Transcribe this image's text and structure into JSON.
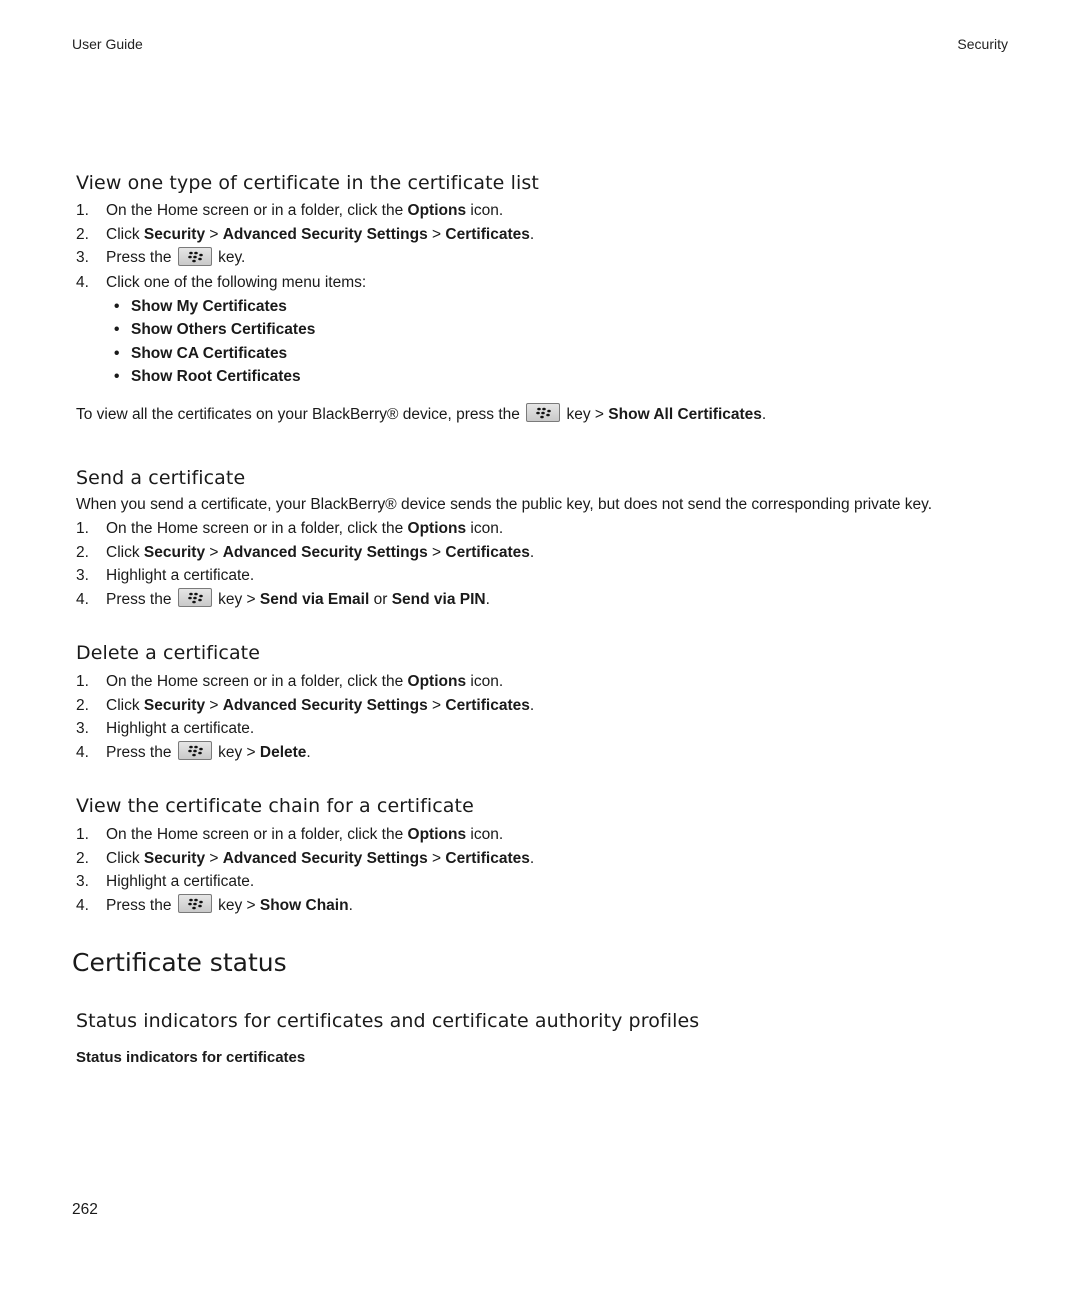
{
  "header": {
    "left": "User Guide",
    "right": "Security"
  },
  "sections": {
    "view_type": {
      "title": "View one type of certificate in the certificate list",
      "steps": {
        "s1": {
          "num": "1.",
          "pre": "On the Home screen or in a folder, click the ",
          "b1": "Options",
          "post": " icon."
        },
        "s2": {
          "num": "2.",
          "pre": "Click ",
          "b1": "Security",
          "sep1": " > ",
          "b2": "Advanced Security Settings",
          "sep2": " > ",
          "b3": "Certificates",
          "post": "."
        },
        "s3": {
          "num": "3.",
          "pre": "Press the ",
          "post": " key."
        },
        "s4": {
          "num": "4.",
          "text": "Click one of the following menu items:"
        }
      },
      "menu_items": [
        "Show My Certificates",
        "Show Others Certificates",
        "Show CA Certificates",
        "Show Root Certificates"
      ],
      "note": {
        "pre": "To view all the certificates on your BlackBerry® device, press the ",
        "mid": " key > ",
        "b1": "Show All Certificates",
        "post": "."
      }
    },
    "send": {
      "title": "Send a certificate",
      "intro": "When you send a certificate, your BlackBerry® device sends the public key, but does not send the corresponding private key.",
      "steps": {
        "s1": {
          "num": "1.",
          "pre": "On the Home screen or in a folder, click the ",
          "b1": "Options",
          "post": " icon."
        },
        "s2": {
          "num": "2.",
          "pre": "Click ",
          "b1": "Security",
          "sep1": " > ",
          "b2": "Advanced Security Settings",
          "sep2": " > ",
          "b3": "Certificates",
          "post": "."
        },
        "s3": {
          "num": "3.",
          "text": "Highlight a certificate."
        },
        "s4": {
          "num": "4.",
          "pre": "Press the ",
          "mid": " key > ",
          "b1": "Send via Email",
          "or": " or ",
          "b2": "Send via PIN",
          "post": "."
        }
      }
    },
    "delete": {
      "title": "Delete a certificate",
      "steps": {
        "s1": {
          "num": "1.",
          "pre": "On the Home screen or in a folder, click the ",
          "b1": "Options",
          "post": " icon."
        },
        "s2": {
          "num": "2.",
          "pre": "Click ",
          "b1": "Security",
          "sep1": " > ",
          "b2": "Advanced Security Settings",
          "sep2": " > ",
          "b3": "Certificates",
          "post": "."
        },
        "s3": {
          "num": "3.",
          "text": "Highlight a certificate."
        },
        "s4": {
          "num": "4.",
          "pre": "Press the ",
          "mid": " key > ",
          "b1": "Delete",
          "post": "."
        }
      }
    },
    "chain": {
      "title": "View the certificate chain for a certificate",
      "steps": {
        "s1": {
          "num": "1.",
          "pre": "On the Home screen or in a folder, click the ",
          "b1": "Options",
          "post": " icon."
        },
        "s2": {
          "num": "2.",
          "pre": "Click ",
          "b1": "Security",
          "sep1": " > ",
          "b2": "Advanced Security Settings",
          "sep2": " > ",
          "b3": "Certificates",
          "post": "."
        },
        "s3": {
          "num": "3.",
          "text": "Highlight a certificate."
        },
        "s4": {
          "num": "4.",
          "pre": "Press the ",
          "mid": " key > ",
          "b1": "Show Chain",
          "post": "."
        }
      }
    },
    "status": {
      "title": "Certificate status",
      "subtitle": "Status indicators for certificates and certificate authority profiles",
      "subheading": "Status indicators for certificates"
    }
  },
  "footer": {
    "page_number": "262"
  },
  "icons": {
    "menu_key": "blackberry-menu-key-icon"
  }
}
